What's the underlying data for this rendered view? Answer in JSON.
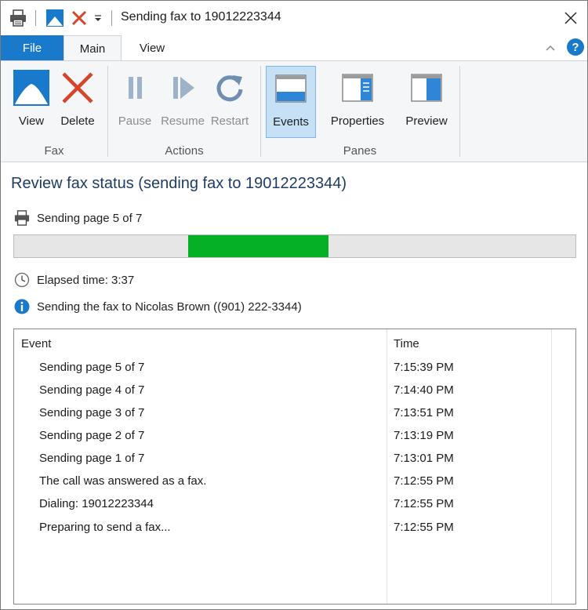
{
  "window": {
    "title": "Sending fax to 19012223344"
  },
  "ribbon": {
    "tabs": [
      {
        "label": "File"
      },
      {
        "label": "Main"
      },
      {
        "label": "View"
      }
    ],
    "help_label": "?",
    "buttons": {
      "view": "View",
      "delete": "Delete",
      "pause": "Pause",
      "resume": "Resume",
      "restart": "Restart",
      "events": "Events",
      "properties": "Properties",
      "preview": "Preview"
    },
    "groups": {
      "fax": "Fax",
      "actions": "Actions",
      "panes": "Panes"
    }
  },
  "status": {
    "heading": "Review fax status (sending fax to 19012223344)",
    "page_progress": "Sending page 5 of 7",
    "progress": {
      "start_fraction": 0.31,
      "fill_fraction": 0.25
    },
    "elapsed": "Elapsed time: 3:37",
    "info": "Sending the fax to Nicolas Brown ((901) 222-3344)"
  },
  "events_table": {
    "columns": [
      "Event",
      "Time"
    ],
    "rows": [
      {
        "event": "Sending page 5 of 7",
        "time": "7:15:39 PM"
      },
      {
        "event": "Sending page 4 of 7",
        "time": "7:14:40 PM"
      },
      {
        "event": "Sending page 3 of 7",
        "time": "7:13:51 PM"
      },
      {
        "event": "Sending page 2 of 7",
        "time": "7:13:19 PM"
      },
      {
        "event": "Sending page 1 of 7",
        "time": "7:13:01 PM"
      },
      {
        "event": "The call was answered as a fax.",
        "time": "7:12:55 PM"
      },
      {
        "event": "Dialing: 19012223344",
        "time": "7:12:55 PM"
      },
      {
        "event": "Preparing to send a fax...",
        "time": "7:12:55 PM"
      }
    ]
  },
  "colors": {
    "accent": "#1979ca",
    "progress_fill": "#06b025",
    "delete_red": "#d8442a",
    "heading": "#1e3c64"
  },
  "icons": {
    "app": "fax-printer-icon",
    "view": "picture-icon",
    "delete": "red-x-icon",
    "pause": "pause-icon",
    "resume": "resume-icon",
    "restart": "restart-icon",
    "events": "events-pane-icon",
    "properties": "properties-pane-icon",
    "preview": "preview-pane-icon",
    "elapsed": "clock-icon",
    "info": "info-icon"
  }
}
